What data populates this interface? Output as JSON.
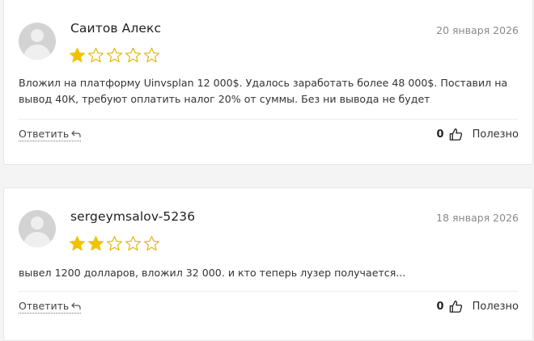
{
  "reviews": [
    {
      "author": "Саитов Алекс",
      "date": "20 января 2026",
      "rating": 1,
      "max_rating": 5,
      "text": "Вложил на платформу Uinvsplan 12 000$. Удалось заработать более 48 000$. Поставил на вывод 40К, требуют оплатить налог 20% от суммы. Без ни вывода не будет",
      "reply_label": "Ответить",
      "likes": "0",
      "useful_label": "Полезно"
    },
    {
      "author": "sergeymsalov-5236",
      "date": "18 января 2026",
      "rating": 2,
      "max_rating": 5,
      "text": "вывел 1200 долларов, вложил 32 000. и кто теперь лузер получается...",
      "reply_label": "Ответить",
      "likes": "0",
      "useful_label": "Полезно"
    }
  ],
  "colors": {
    "star_filled": "#f2c200",
    "star_empty_stroke": "#e0b400"
  },
  "icons": {
    "reply": "reply-arrow-icon",
    "like": "thumbs-up-icon",
    "avatar": "user-placeholder-icon"
  }
}
